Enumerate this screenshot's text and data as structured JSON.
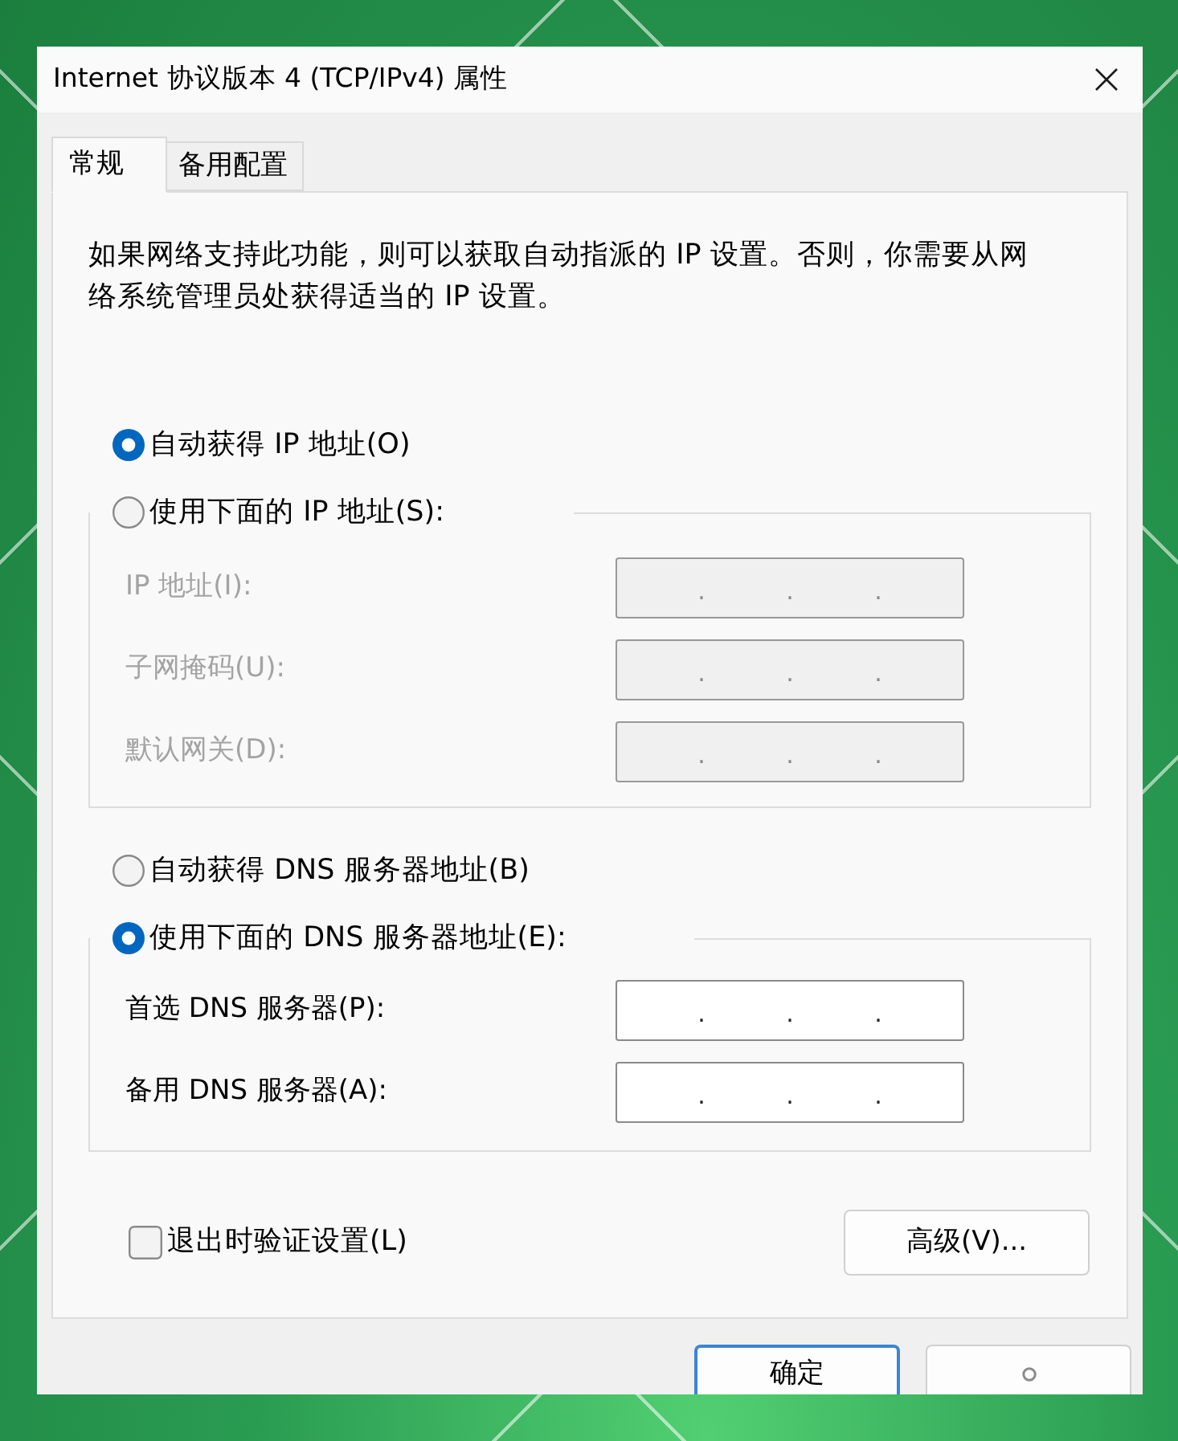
{
  "window": {
    "title": "Internet 协议版本 4 (TCP/IPv4) 属性"
  },
  "tabs": [
    {
      "label": "常规",
      "selected": true
    },
    {
      "label": "备用配置",
      "selected": false
    }
  ],
  "description": "如果网络支持此功能，则可以获取自动指派的 IP 设置。否则，你需要从网络系统管理员处获得适当的 IP 设置。",
  "ip_settings": {
    "auto_option": {
      "label": "自动获得 IP 地址(O)",
      "selected": true
    },
    "manual_option": {
      "label": "使用下面的 IP 地址(S):",
      "selected": false
    },
    "fields": [
      {
        "label": "IP 地址(I):",
        "disabled": true,
        "separators": [
          ".",
          ".",
          "."
        ]
      },
      {
        "label": "子网掩码(U):",
        "disabled": true,
        "separators": [
          ".",
          ".",
          "."
        ]
      },
      {
        "label": "默认网关(D):",
        "disabled": true,
        "separators": [
          ".",
          ".",
          "."
        ]
      }
    ]
  },
  "dns_settings": {
    "auto_option": {
      "label": "自动获得 DNS 服务器地址(B)",
      "selected": false
    },
    "manual_option": {
      "label": "使用下面的 DNS 服务器地址(E):",
      "selected": true
    },
    "fields": [
      {
        "label": "首选 DNS 服务器(P):",
        "disabled": false,
        "separators": [
          ".",
          ".",
          "."
        ]
      },
      {
        "label": "备用 DNS 服务器(A):",
        "disabled": false,
        "separators": [
          ".",
          ".",
          "."
        ]
      }
    ]
  },
  "validate_on_exit": {
    "label": "退出时验证设置(L)",
    "checked": false
  },
  "advanced_button": {
    "label": "高级(V)..."
  },
  "footer_buttons": [
    {
      "kind": "text",
      "label": "确定",
      "default": true
    },
    {
      "kind": "icon",
      "default": false
    }
  ]
}
